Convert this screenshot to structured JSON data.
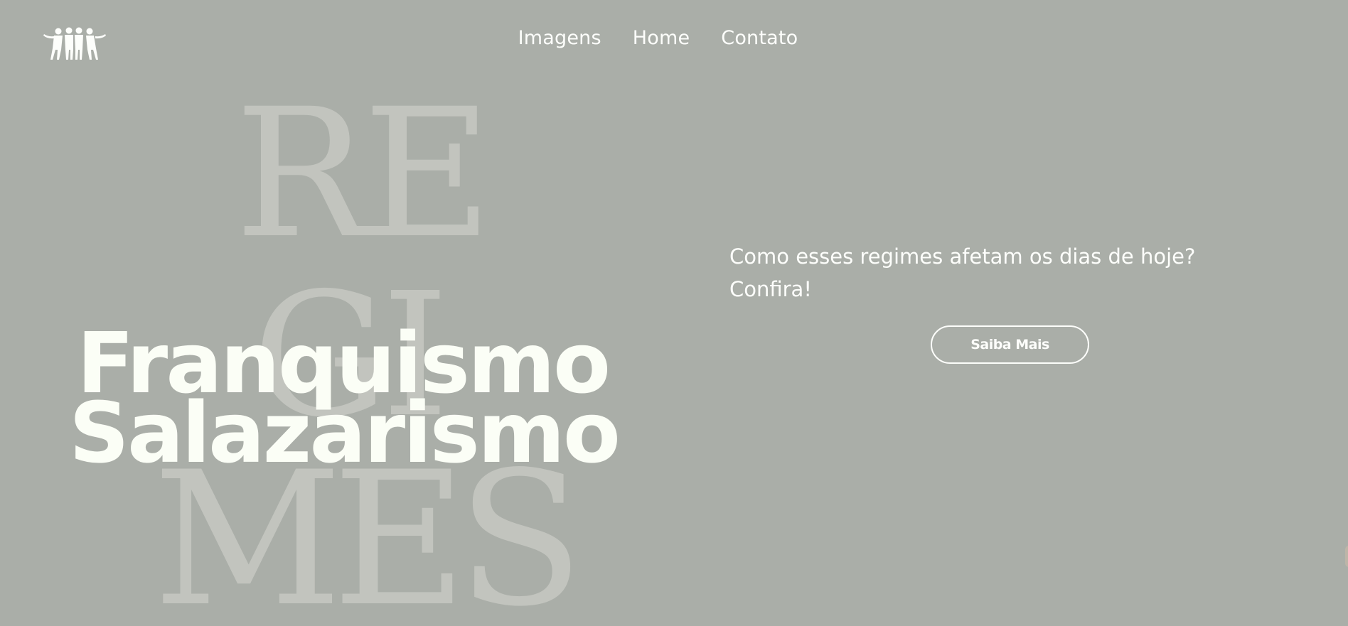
{
  "header": {
    "logo_icon": "people-group-icon",
    "nav": [
      {
        "label": "Imagens"
      },
      {
        "label": "Home"
      },
      {
        "label": "Contato"
      }
    ]
  },
  "background": {
    "lines": [
      "RE",
      "GI",
      "MES"
    ]
  },
  "hero": {
    "title_line1": "Franquismo",
    "title_line2": "Salazarismo"
  },
  "aside": {
    "tagline": "Como esses regimes afetam os dias de hoje? Confira!",
    "cta_label": "Saiba Mais"
  },
  "colors": {
    "background": "#aaaea8",
    "foreground": "#f7faf4",
    "decorative_text": "#c2c4be"
  }
}
